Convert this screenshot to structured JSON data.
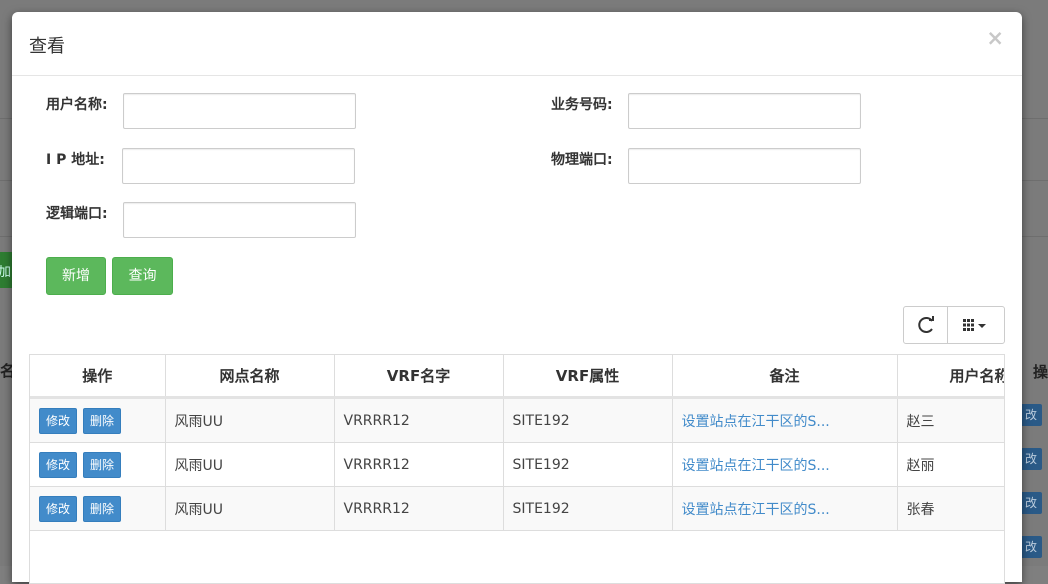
{
  "background": {
    "left_header": "名称",
    "right_header": "操",
    "left_button": "加",
    "row_button": "改"
  },
  "modal": {
    "title": "查看",
    "close_label": "×"
  },
  "form": {
    "user_name": {
      "label": "用户名称:",
      "value": ""
    },
    "business_no": {
      "label": "业务号码:",
      "value": ""
    },
    "ip_address": {
      "label": "I P 地址:",
      "value": ""
    },
    "physical_port": {
      "label": "物理端口:",
      "value": ""
    },
    "logical_port": {
      "label": "逻辑端口:",
      "value": ""
    }
  },
  "buttons": {
    "add": "新增",
    "query": "查询"
  },
  "toolbar": {
    "refresh_icon": "refresh-icon",
    "columns_icon": "grid-icon"
  },
  "table": {
    "columns": [
      "操作",
      "网点名称",
      "VRF名字",
      "VRF属性",
      "备注",
      "用户名称"
    ],
    "edit_label": "修改",
    "delete_label": "删除",
    "rows": [
      {
        "site": "风雨UU",
        "vrf_name": "VRRRR12",
        "vrf_attr": "SITE192",
        "note": "设置站点在江干区的S...",
        "user": "赵三"
      },
      {
        "site": "风雨UU",
        "vrf_name": "VRRRR12",
        "vrf_attr": "SITE192",
        "note": "设置站点在江干区的S...",
        "user": "赵丽"
      },
      {
        "site": "风雨UU",
        "vrf_name": "VRRRR12",
        "vrf_attr": "SITE192",
        "note": "设置站点在江干区的S...",
        "user": "张春"
      }
    ]
  },
  "colors": {
    "primary": "#428bca",
    "success": "#5cb85c",
    "link": "#428bca"
  }
}
